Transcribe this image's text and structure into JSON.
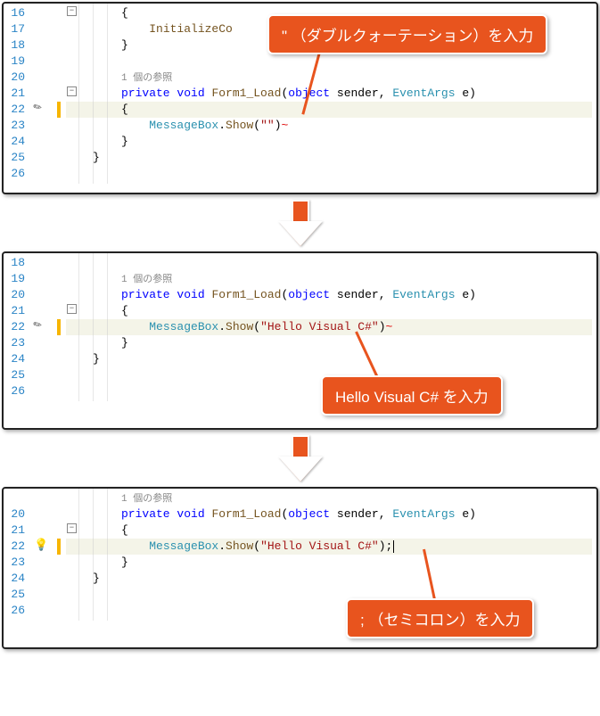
{
  "colors": {
    "accent": "#e8541e",
    "keyword": "#0000ff",
    "type": "#2b91af",
    "string": "#a31515"
  },
  "reference_label": "1 個の参照",
  "callouts": {
    "c1": "\" （ダブルクォーテーション）を入力",
    "c2": "Hello Visual C# を入力",
    "c3": "; （セミコロン）を入力"
  },
  "tokens": {
    "private": "private",
    "void": "void",
    "method": "Form1_Load",
    "object": "object",
    "sender": "sender",
    "eargs": "EventArgs",
    "e": "e",
    "msgbox": "MessageBox",
    "show": "Show",
    "init": "InitializeCo",
    "str_empty": "\"\"",
    "str_hello": "\"Hello Visual C#\"",
    "semicolon": ";"
  },
  "panel1": {
    "lines": [
      "16",
      "17",
      "18",
      "19",
      "20",
      "21",
      "22",
      "23",
      "24",
      "25",
      "26"
    ],
    "fold_rows": [
      0,
      5
    ],
    "highlight_row": 6
  },
  "panel2": {
    "lines": [
      "18",
      "19",
      "20",
      "21",
      "22",
      "23",
      "24",
      "25",
      "26"
    ],
    "fold_rows": [
      3
    ],
    "highlight_row": 4
  },
  "panel3": {
    "lines": [
      "20",
      "21",
      "22",
      "23",
      "24",
      "25",
      "26"
    ],
    "fold_rows": [
      1
    ],
    "highlight_row": 2
  }
}
